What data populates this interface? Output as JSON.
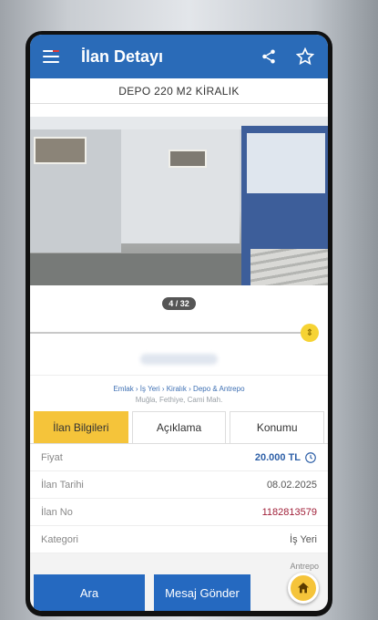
{
  "header": {
    "title": "İlan Detayı",
    "icons": [
      "menu-icon",
      "share-icon",
      "star-icon"
    ]
  },
  "listing": {
    "title": "DEPO 220 M2 KİRALIK",
    "photo_counter": "4 / 32",
    "breadcrumb": "Emlak › İş Yeri › Kiralık › Depo & Antrepo",
    "location": "Muğla, Fethiye, Cami Mah."
  },
  "tabs": [
    {
      "label": "İlan Bilgileri",
      "active": true
    },
    {
      "label": "Açıklama",
      "active": false
    },
    {
      "label": "Konumu",
      "active": false
    }
  ],
  "details": [
    {
      "label": "Fiyat",
      "value": "20.000 TL"
    },
    {
      "label": "İlan Tarihi",
      "value": "08.02.2025"
    },
    {
      "label": "İlan No",
      "value": "1182813579"
    },
    {
      "label": "Kategori",
      "value": "İş Yeri"
    }
  ],
  "bottom": {
    "search_label": "Ara",
    "message_label": "Mesaj Gönder",
    "peek_label": "Antrepo"
  },
  "colors": {
    "primary": "#2a6bb8",
    "accent": "#f5c43a",
    "price": "#2d5fa7",
    "listing_no": "#a01f38"
  }
}
